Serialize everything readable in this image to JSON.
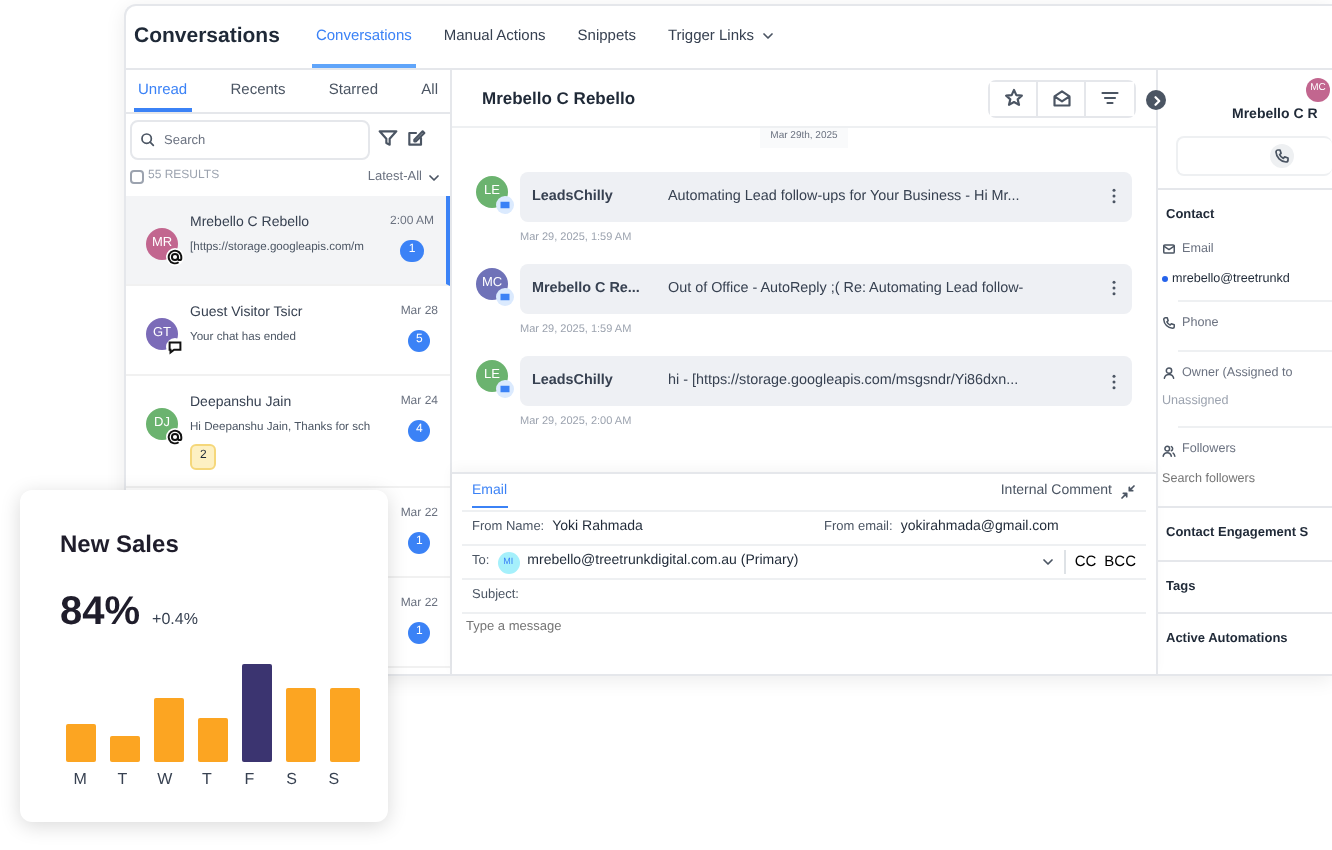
{
  "window": {
    "title": "Conversations"
  },
  "nav_tabs": [
    {
      "label": "Conversations",
      "selected": true,
      "dropdown": false
    },
    {
      "label": "Manual Actions",
      "selected": false,
      "dropdown": false
    },
    {
      "label": "Snippets",
      "selected": false,
      "dropdown": false
    },
    {
      "label": "Trigger Links",
      "selected": false,
      "dropdown": true
    }
  ],
  "inbox": {
    "tabs": [
      {
        "label": "Unread",
        "selected": true
      },
      {
        "label": "Recents",
        "selected": false
      },
      {
        "label": "Starred",
        "selected": false
      },
      {
        "label": "All",
        "selected": false
      }
    ],
    "search": {
      "placeholder": "Search"
    },
    "results": "55 RESULTS",
    "select_all": false,
    "sort": "Latest-All",
    "conversations": [
      {
        "initials": "MR",
        "color": "#c2668f",
        "kind": "email",
        "name": "Mrebello C Rebello",
        "preview": "[https://storage.googleapis.com/m",
        "time": "2:00 AM",
        "unread": "1",
        "selected": true
      },
      {
        "initials": "GT",
        "color": "#7b6bb8",
        "kind": "chat",
        "name": "Guest Visitor Tsicr",
        "preview": "Your chat has ended",
        "time": "Mar 28",
        "unread": "5",
        "selected": false
      },
      {
        "initials": "DJ",
        "color": "#6bb36f",
        "kind": "email",
        "name": "Deepanshu Jain",
        "preview": "Hi Deepanshu Jain, Thanks for sch",
        "time": "Mar 24",
        "unread": "4",
        "tag": "2",
        "selected": false
      },
      {
        "time": "Mar 22",
        "unread": "1",
        "selected": false
      },
      {
        "time": "Mar 22",
        "unread": "1",
        "selected": false
      }
    ]
  },
  "thread": {
    "title": "Mrebello C Rebello",
    "date": "Mar 29th, 2025",
    "messages": [
      {
        "initials": "LE",
        "color": "#6bb36f",
        "sender": "LeadsChilly",
        "text": "Automating Lead follow-ups for Your Business  -  Hi Mr...",
        "time": "Mar 29, 2025, 1:59 AM"
      },
      {
        "initials": "MC",
        "color": "#6f72b8",
        "sender": "Mrebello C Re...",
        "text": "Out of Office - AutoReply ;( Re: Automating Lead follow-",
        "time": "Mar 29, 2025, 1:59 AM"
      },
      {
        "initials": "LE",
        "color": "#6bb36f",
        "sender": "LeadsChilly",
        "text": "hi  -  [https://storage.googleapis.com/msgsndr/Yi86dxn...",
        "time": "Mar 29, 2025, 2:00 AM"
      }
    ]
  },
  "composer": {
    "tabs": [
      {
        "label": "Email",
        "selected": true
      },
      {
        "label": "Internal Comment",
        "selected": false
      }
    ],
    "from_name_label": "From Name:",
    "from_name": "Yoki Rahmada",
    "from_email_label": "From email:",
    "from_email": "yokirahmada@gmail.com",
    "to_label": "To:",
    "to_initials": "MI",
    "to_address": "mrebello@treetrunkdigital.com.au (Primary)",
    "cc": "CC",
    "bcc": "BCC",
    "subject_label": "Subject:",
    "placeholder": "Type a message"
  },
  "contact_panel": {
    "initials": "MC",
    "color": "#c2668f",
    "name": "Mrebello C R",
    "section": "Contact",
    "fields": [
      {
        "kind": "email",
        "label": "Email",
        "value": "mrebello@treetrunkd"
      },
      {
        "kind": "phone",
        "label": "Phone"
      },
      {
        "kind": "owner",
        "label": "Owner (Assigned to",
        "value": "Unassigned"
      },
      {
        "kind": "followers",
        "label": "Followers",
        "placeholder": "Search followers"
      }
    ],
    "sections": [
      "Contact Engagement S",
      "Tags",
      "Active Automations"
    ]
  },
  "sales_card": {
    "title": "New Sales",
    "value": "84%",
    "change": "+0.4%",
    "days": [
      {
        "label": "M",
        "selected": false
      },
      {
        "label": "T",
        "selected": false
      },
      {
        "label": "W",
        "selected": false
      },
      {
        "label": "T",
        "selected": false
      },
      {
        "label": "F",
        "selected": true
      },
      {
        "label": "S",
        "selected": false
      },
      {
        "label": "S",
        "selected": false
      }
    ]
  }
}
